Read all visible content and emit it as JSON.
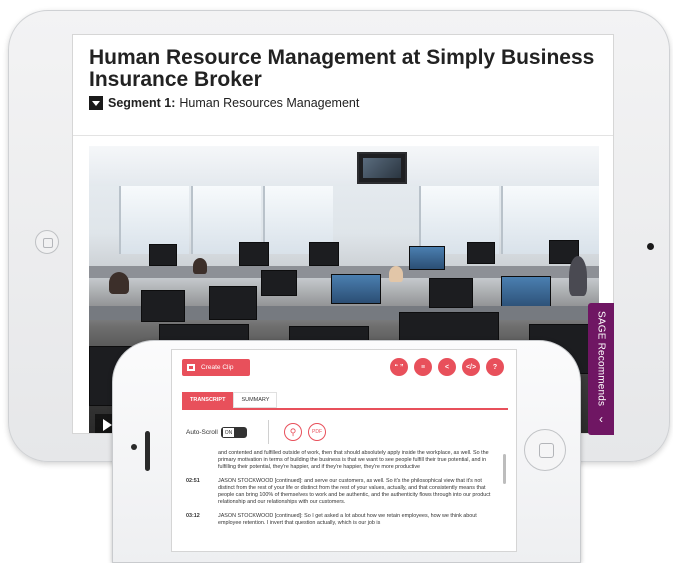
{
  "tablet": {
    "video_title": "Human Resource Management at Simply Business Insurance Broker",
    "segment_prefix": "Segment 1:",
    "segment_name": "Human Resources Management",
    "sage_label": "SAGE Recommends",
    "sage_chevron": "‹"
  },
  "phone": {
    "create_clip_label": "Create Clip",
    "tool_icons": [
      "“ ”",
      "≡",
      "<",
      "</>",
      "?"
    ],
    "tabs": [
      "TRANSCRIPT",
      "SUMMARY"
    ],
    "autoscroll_label": "Auto-Scroll",
    "toggle_label": "ON",
    "search_glyph": "⚲",
    "pdf_label": "PDF",
    "transcript": [
      {
        "time": "",
        "text": "and contented and fulfilled outside of work, then that should absolutely apply inside the workplace, as well. So the primary motivation in terms of building the business is that we want to see people fulfill their true potential, and in fulfilling their potential, they're happier, and if they're happier, they're more productive"
      },
      {
        "time": "02:51",
        "text": "JASON STOCKWOOD [continued]: and serve our customers, as well. So it's the philosophical view that it's not distinct from the rest of your life or distinct from the rest of your values, actually, and that consistently means that people can bring 100% of themselves to work and be authentic, and the authenticity flows through into our product relationship and our relationships with our customers."
      },
      {
        "time": "03:12",
        "text": "JASON STOCKWOOD [continued]: So I get asked a lot about how we retain employees, how we think about employee retention. I invert that question actually, which is our job is"
      }
    ]
  },
  "colors": {
    "accent": "#e8505b",
    "sage_purple": "#6f1663"
  }
}
